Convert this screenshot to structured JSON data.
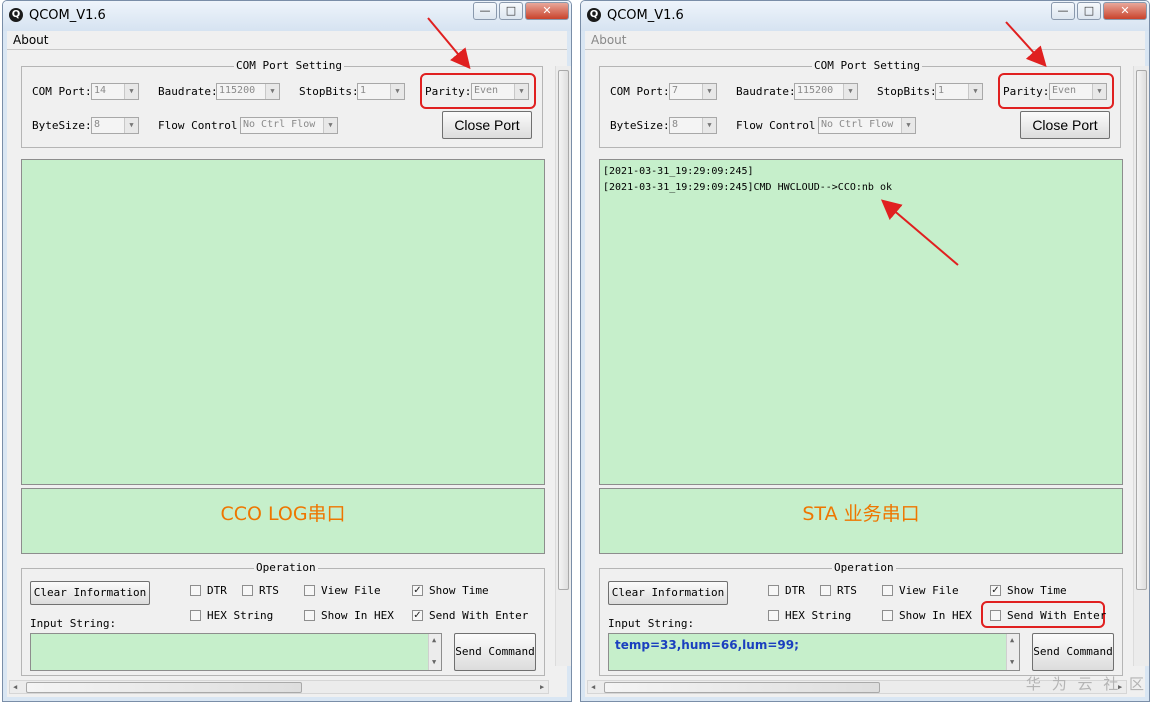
{
  "windows": [
    {
      "title": "QCOM_V1.6",
      "menu": "About",
      "com_group_title": "COM Port Setting",
      "com_port_label": "COM Port:",
      "com_port_value": "14",
      "baud_label": "Baudrate:",
      "baud_value": "115200",
      "stopbits_label": "StopBits:",
      "stopbits_value": "1",
      "parity_label": "Parity:",
      "parity_value": "Even",
      "bytesize_label": "ByteSize:",
      "bytesize_value": "8",
      "flow_label": "Flow Control:",
      "flow_value": "No Ctrl Flow",
      "close_port": "Close Port",
      "log_lines": [
        "",
        ""
      ],
      "pane_label": "CCO LOG串口",
      "op_group_title": "Operation",
      "clear_info": "Clear Information",
      "dtr": "DTR",
      "rts": "RTS",
      "view_file": "View File",
      "show_time": "Show Time",
      "hex_string": "HEX String",
      "show_in_hex": "Show In HEX",
      "send_with_enter": "Send With Enter",
      "input_label": "Input String:",
      "input_value": "",
      "send_command": "Send Command",
      "checks": {
        "dtr": false,
        "rts": false,
        "view_file": false,
        "show_time": true,
        "hex_string": false,
        "show_in_hex": false,
        "send_with_enter": true
      }
    },
    {
      "title": "QCOM_V1.6",
      "menu": "About",
      "com_group_title": "COM Port Setting",
      "com_port_label": "COM Port:",
      "com_port_value": "7",
      "baud_label": "Baudrate:",
      "baud_value": "115200",
      "stopbits_label": "StopBits:",
      "stopbits_value": "1",
      "parity_label": "Parity:",
      "parity_value": "Even",
      "bytesize_label": "ByteSize:",
      "bytesize_value": "8",
      "flow_label": "Flow Control:",
      "flow_value": "No Ctrl Flow",
      "close_port": "Close Port",
      "log_lines": [
        "[2021-03-31_19:29:09:245]",
        "[2021-03-31_19:29:09:245]CMD HWCLOUD-->CCO:nb ok"
      ],
      "pane_label": "STA 业务串口",
      "op_group_title": "Operation",
      "clear_info": "Clear Information",
      "dtr": "DTR",
      "rts": "RTS",
      "view_file": "View File",
      "show_time": "Show Time",
      "hex_string": "HEX String",
      "show_in_hex": "Show In HEX",
      "send_with_enter": "Send With Enter",
      "input_label": "Input String:",
      "input_value": "temp=33,hum=66,lum=99;",
      "send_command": "Send Command",
      "checks": {
        "dtr": false,
        "rts": false,
        "view_file": false,
        "show_time": true,
        "hex_string": false,
        "show_in_hex": false,
        "send_with_enter": false
      }
    }
  ],
  "watermark": "华 为 云 社 区",
  "colors": {
    "pane_bg": "#c6efcb",
    "highlight": "#e02020",
    "label_orange": "#ee7600",
    "input_text": "#1a3fbf"
  }
}
